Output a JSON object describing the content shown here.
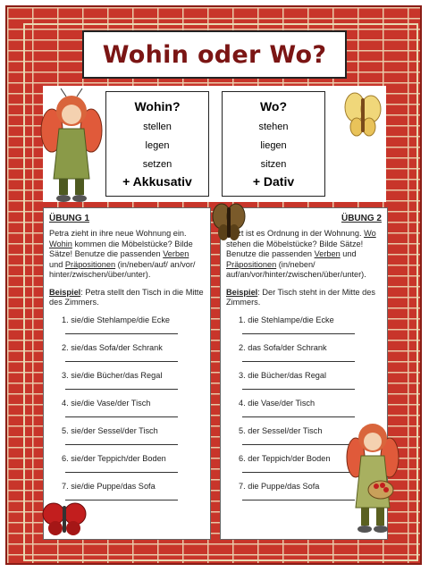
{
  "title": "Wohin oder Wo?",
  "wohin": {
    "heading": "Wohin?",
    "verbs": [
      "stellen",
      "legen",
      "setzen"
    ],
    "case": "+ Akkusativ"
  },
  "wo": {
    "heading": "Wo?",
    "verbs": [
      "stehen",
      "liegen",
      "sitzen"
    ],
    "case": "+ Dativ"
  },
  "uebung1": {
    "heading": "ÜBUNG 1",
    "intro_a": "Petra zieht in ihre neue Wohnung ein. ",
    "intro_kw": "Wohin",
    "intro_b": " kommen die Möbelstücke? Bilde Sätze! Benutze die passenden ",
    "intro_verben": "Verben",
    "intro_c": " und ",
    "intro_praep": "Präpositionen",
    "intro_d": " (in/neben/auf/ an/vor/ hinter/zwischen/über/unter).",
    "beispiel_label": "Beispiel",
    "beispiel_text": ": Petra stellt den Tisch in die Mitte des Zimmers.",
    "items": [
      "1. sie/die Stehlampe/die Ecke",
      "2. sie/das Sofa/der Schrank",
      "3. sie/die Bücher/das Regal",
      "4. sie/die Vase/der Tisch",
      "5. sie/der Sessel/der Tisch",
      "6. sie/der Teppich/der Boden",
      "7. sie/die Puppe/das Sofa"
    ]
  },
  "uebung2": {
    "heading": "ÜBUNG 2",
    "intro_a": "Jetzt ist es Ordnung in der Wohnung. ",
    "intro_kw": "Wo",
    "intro_b": " stehen die Möbelstücke? Bilde Sätze! Benutze die passenden ",
    "intro_verben": "Verben",
    "intro_c": " und ",
    "intro_praep": "Präpositionen",
    "intro_d": " (in/neben/ auf/an/vor/hinter/zwischen/über/unter).",
    "beispiel_label": "Beispiel",
    "beispiel_text": ": Der Tisch steht in der Mitte des Zimmers.",
    "items": [
      "1. die Stehlampe/die Ecke",
      "2. das Sofa/der Schrank",
      "3. die Bücher/das Regal",
      "4. die Vase/der Tisch",
      "5. der Sessel/der Tisch",
      "6. der Teppich/der Boden",
      "7. die Puppe/das Sofa"
    ]
  },
  "colors": {
    "brick": "#c8352a",
    "title": "#7b1514"
  },
  "icons": [
    "butterfly-girl-icon",
    "butterfly-icon",
    "butterfly-girl-basket-icon"
  ]
}
